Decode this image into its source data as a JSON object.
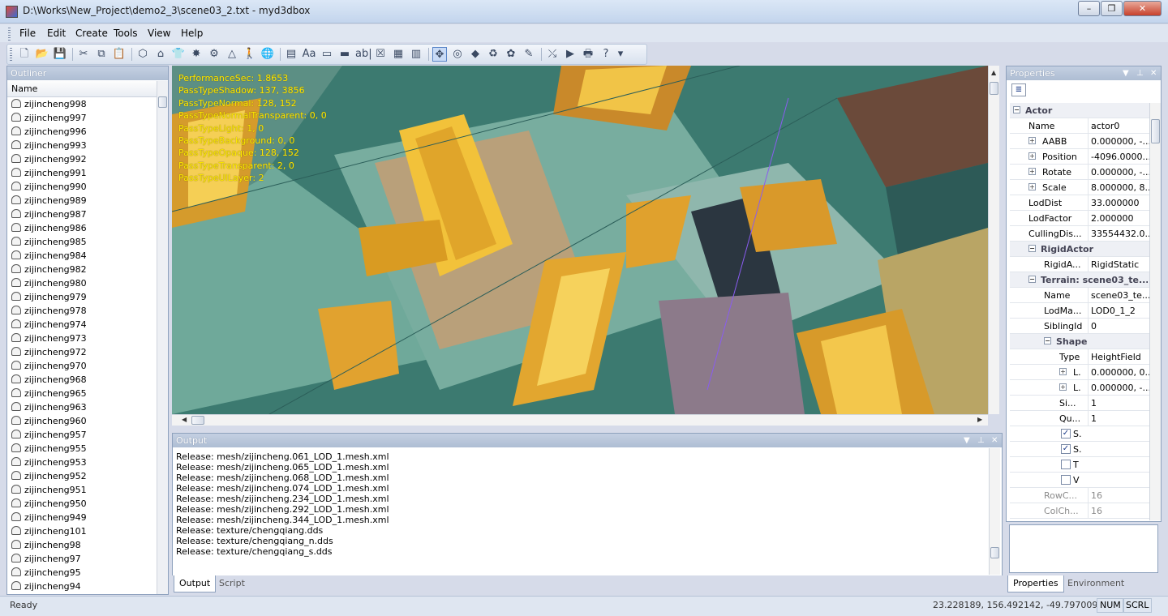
{
  "window": {
    "title": "D:\\Works\\New_Project\\demo2_3\\scene03_2.txt - myd3dbox",
    "minimize": "–",
    "restore": "❐",
    "close": "✕"
  },
  "menu": [
    "File",
    "Edit",
    "Create",
    "Tools",
    "View",
    "Help"
  ],
  "toolbar": {
    "icons": [
      "new-file-icon",
      "open-folder-icon",
      "save-icon",
      "cut-icon",
      "copy-icon",
      "paste-icon",
      "cube-icon",
      "box-icon",
      "shirt-icon",
      "particles-icon",
      "gear-icon",
      "cone-icon",
      "person-icon",
      "globe-icon",
      "text-box-icon",
      "text-style-icon",
      "button-icon",
      "input-icon",
      "edit-text-icon",
      "close-box-icon",
      "grid-icon",
      "table-icon",
      "move-tool-icon",
      "rotate-tool-icon",
      "terrain-icon",
      "cloth-icon",
      "grass-icon",
      "brush-icon",
      "debug-icon",
      "play-icon",
      "print-icon",
      "help-icon"
    ],
    "glyphs": [
      "🗋",
      "📂",
      "💾",
      "✂",
      "⧉",
      "📋",
      "⬡",
      "⌂",
      "👕",
      "✸",
      "⚙",
      "△",
      "🚶",
      "🌐",
      "▤",
      "Aa",
      "▭",
      "▬",
      "ab|",
      "☒",
      "▦",
      "▥",
      "✥",
      "◎",
      "◆",
      "♻",
      "✿",
      "✎",
      "⤯",
      "▶",
      "🖶",
      "?"
    ]
  },
  "outliner": {
    "title": "Outliner",
    "column": "Name",
    "items": [
      "zijincheng998",
      "zijincheng997",
      "zijincheng996",
      "zijincheng993",
      "zijincheng992",
      "zijincheng991",
      "zijincheng990",
      "zijincheng989",
      "zijincheng987",
      "zijincheng986",
      "zijincheng985",
      "zijincheng984",
      "zijincheng982",
      "zijincheng980",
      "zijincheng979",
      "zijincheng978",
      "zijincheng974",
      "zijincheng973",
      "zijincheng972",
      "zijincheng970",
      "zijincheng968",
      "zijincheng965",
      "zijincheng963",
      "zijincheng960",
      "zijincheng957",
      "zijincheng955",
      "zijincheng953",
      "zijincheng952",
      "zijincheng951",
      "zijincheng950",
      "zijincheng949",
      "zijincheng101",
      "zijincheng98",
      "zijincheng97",
      "zijincheng95",
      "zijincheng94"
    ]
  },
  "viewport": {
    "stats": [
      "PerformanceSec: 1.8653",
      "PassTypeShadow: 137, 3856",
      "PassTypeNormal: 128, 152",
      "PassTypeNormalTransparent: 0, 0",
      "PassTypeLight: 1, 0",
      "PassTypeBackground: 0, 0",
      "PassTypeOpaque: 128, 152",
      "PassTypeTransparent: 2, 0",
      "PassTypeUILayer: 2"
    ]
  },
  "output": {
    "title": "Output",
    "lines": [
      "Release: mesh/zijincheng.061_LOD_1.mesh.xml",
      "Release: mesh/zijincheng.065_LOD_1.mesh.xml",
      "Release: mesh/zijincheng.068_LOD_1.mesh.xml",
      "Release: mesh/zijincheng.074_LOD_1.mesh.xml",
      "Release: mesh/zijincheng.234_LOD_1.mesh.xml",
      "Release: mesh/zijincheng.292_LOD_1.mesh.xml",
      "Release: mesh/zijincheng.344_LOD_1.mesh.xml",
      "Release: texture/chengqiang.dds",
      "Release: texture/chengqiang_n.dds",
      "Release: texture/chengqiang_s.dds"
    ],
    "tabs": [
      "Output",
      "Script"
    ]
  },
  "properties": {
    "title": "Properties",
    "rows": [
      {
        "name": "Actor",
        "value": "",
        "type": "cat",
        "indent": 0,
        "expander": "−"
      },
      {
        "name": "Name",
        "value": "actor0",
        "type": "prop",
        "indent": 1
      },
      {
        "name": "AABB",
        "value": "0.000000, -...",
        "type": "prop",
        "indent": 1,
        "expander": "+"
      },
      {
        "name": "Position",
        "value": "-4096.0000...",
        "type": "prop",
        "indent": 1,
        "expander": "+"
      },
      {
        "name": "Rotate",
        "value": "0.000000, -...",
        "type": "prop",
        "indent": 1,
        "expander": "+"
      },
      {
        "name": "Scale",
        "value": "8.000000, 8...",
        "type": "prop",
        "indent": 1,
        "expander": "+"
      },
      {
        "name": "LodDist",
        "value": "33.000000",
        "type": "prop",
        "indent": 1
      },
      {
        "name": "LodFactor",
        "value": "2.000000",
        "type": "prop",
        "indent": 1
      },
      {
        "name": "CullingDis...",
        "value": "33554432.0...",
        "type": "prop",
        "indent": 1
      },
      {
        "name": "RigidActor",
        "value": "",
        "type": "cat",
        "indent": 1,
        "expander": "−"
      },
      {
        "name": "RigidA...",
        "value": "RigidStatic",
        "type": "prop",
        "indent": 2
      },
      {
        "name": "Terrain: scene03_te...",
        "value": "",
        "type": "cat",
        "indent": 1,
        "expander": "−"
      },
      {
        "name": "Name",
        "value": "scene03_te...",
        "type": "prop",
        "indent": 2
      },
      {
        "name": "LodMa...",
        "value": "LOD0_1_2",
        "type": "prop",
        "indent": 2
      },
      {
        "name": "SiblingId",
        "value": "0",
        "type": "prop",
        "indent": 2
      },
      {
        "name": "Shape",
        "value": "",
        "type": "cat",
        "indent": 2,
        "expander": "−"
      },
      {
        "name": "Type",
        "value": "HeightField",
        "type": "prop",
        "indent": 3
      },
      {
        "name": "L.",
        "value": "0.000000, 0...",
        "type": "prop",
        "indent": 3,
        "expander": "+"
      },
      {
        "name": "L.",
        "value": "0.000000, -...",
        "type": "prop",
        "indent": 3,
        "expander": "+"
      },
      {
        "name": "Si...",
        "value": "1",
        "type": "prop",
        "indent": 3
      },
      {
        "name": "Qu...",
        "value": "1",
        "type": "prop",
        "indent": 3
      },
      {
        "name": "S.",
        "value": "",
        "type": "check",
        "checked": true,
        "indent": 3
      },
      {
        "name": "S.",
        "value": "",
        "type": "check",
        "checked": true,
        "indent": 3
      },
      {
        "name": "T",
        "value": "",
        "type": "check",
        "checked": false,
        "indent": 3
      },
      {
        "name": "V",
        "value": "",
        "type": "check",
        "checked": false,
        "indent": 3
      },
      {
        "name": "RowC...",
        "value": "16",
        "type": "disabled",
        "indent": 2
      },
      {
        "name": "ColCh...",
        "value": "16",
        "type": "disabled",
        "indent": 2
      }
    ],
    "tabs": [
      "Properties",
      "Environment"
    ]
  },
  "status": {
    "text": "Ready",
    "coords": "23.228189, 156.492142, -49.797009",
    "num": "NUM",
    "scrl": "SCRL"
  }
}
